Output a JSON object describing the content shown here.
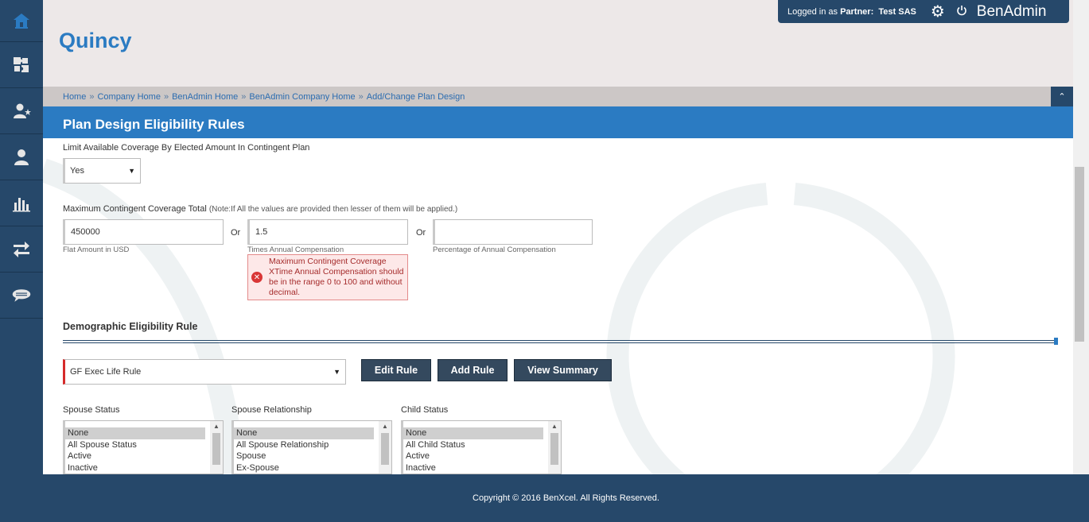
{
  "sidebar": {
    "items": [
      {
        "icon": "home-icon"
      },
      {
        "icon": "puzzle-icon"
      },
      {
        "icon": "user-star-icon"
      },
      {
        "icon": "user-icon"
      },
      {
        "icon": "bar-chart-icon"
      },
      {
        "icon": "transfer-arrows-icon"
      },
      {
        "icon": "chat-bubble-icon"
      }
    ]
  },
  "header": {
    "company": "Quincy",
    "login_prefix": "Logged in as ",
    "login_role": "Partner:",
    "login_user": "Test SAS",
    "brand": "BenAdmin"
  },
  "breadcrumb": {
    "items": [
      "Home",
      "Company Home",
      "BenAdmin Home",
      "BenAdmin Company Home",
      "Add/Change Plan Design"
    ],
    "separator": "»"
  },
  "page": {
    "title": "Plan Design Eligibility Rules"
  },
  "form": {
    "limit_label": "Limit Available Coverage By Elected Amount In Contingent Plan",
    "limit_value": "Yes",
    "max_label": "Maximum Contingent Coverage Total",
    "max_note": "(Note:If All the values are provided then lesser of them will be applied.)",
    "flat_amount_value": "450000",
    "flat_amount_label": "Flat Amount in USD",
    "or_label": "Or",
    "times_value": "1.5",
    "times_label": "Times Annual Compensation",
    "percent_value": "",
    "percent_label": "Percentage of Annual Compensation",
    "error_message": "Maximum Contingent Coverage XTime Annual Compensation should be in the range 0 to 100 and without decimal."
  },
  "demographic": {
    "title": "Demographic Eligibility Rule",
    "rule_value": "GF Exec Life Rule",
    "edit_button": "Edit Rule",
    "add_button": "Add Rule",
    "summary_button": "View Summary",
    "lists": [
      {
        "label": "Spouse Status",
        "options": [
          "None",
          "All Spouse Status",
          "Active",
          "Inactive"
        ]
      },
      {
        "label": "Spouse Relationship",
        "options": [
          "None",
          "All Spouse Relationship",
          "Spouse",
          "Ex-Spouse"
        ]
      },
      {
        "label": "Child Status",
        "options": [
          "None",
          "All Child Status",
          "Active",
          "Inactive"
        ]
      }
    ]
  },
  "footer": {
    "copyright": "Copyright © 2016 BenXcel. All Rights Reserved."
  },
  "colors": {
    "sidebar": "#26486a",
    "accent": "#2b7bc2",
    "header_bg": "#ede8e8",
    "error_bg": "#fde8e8"
  }
}
